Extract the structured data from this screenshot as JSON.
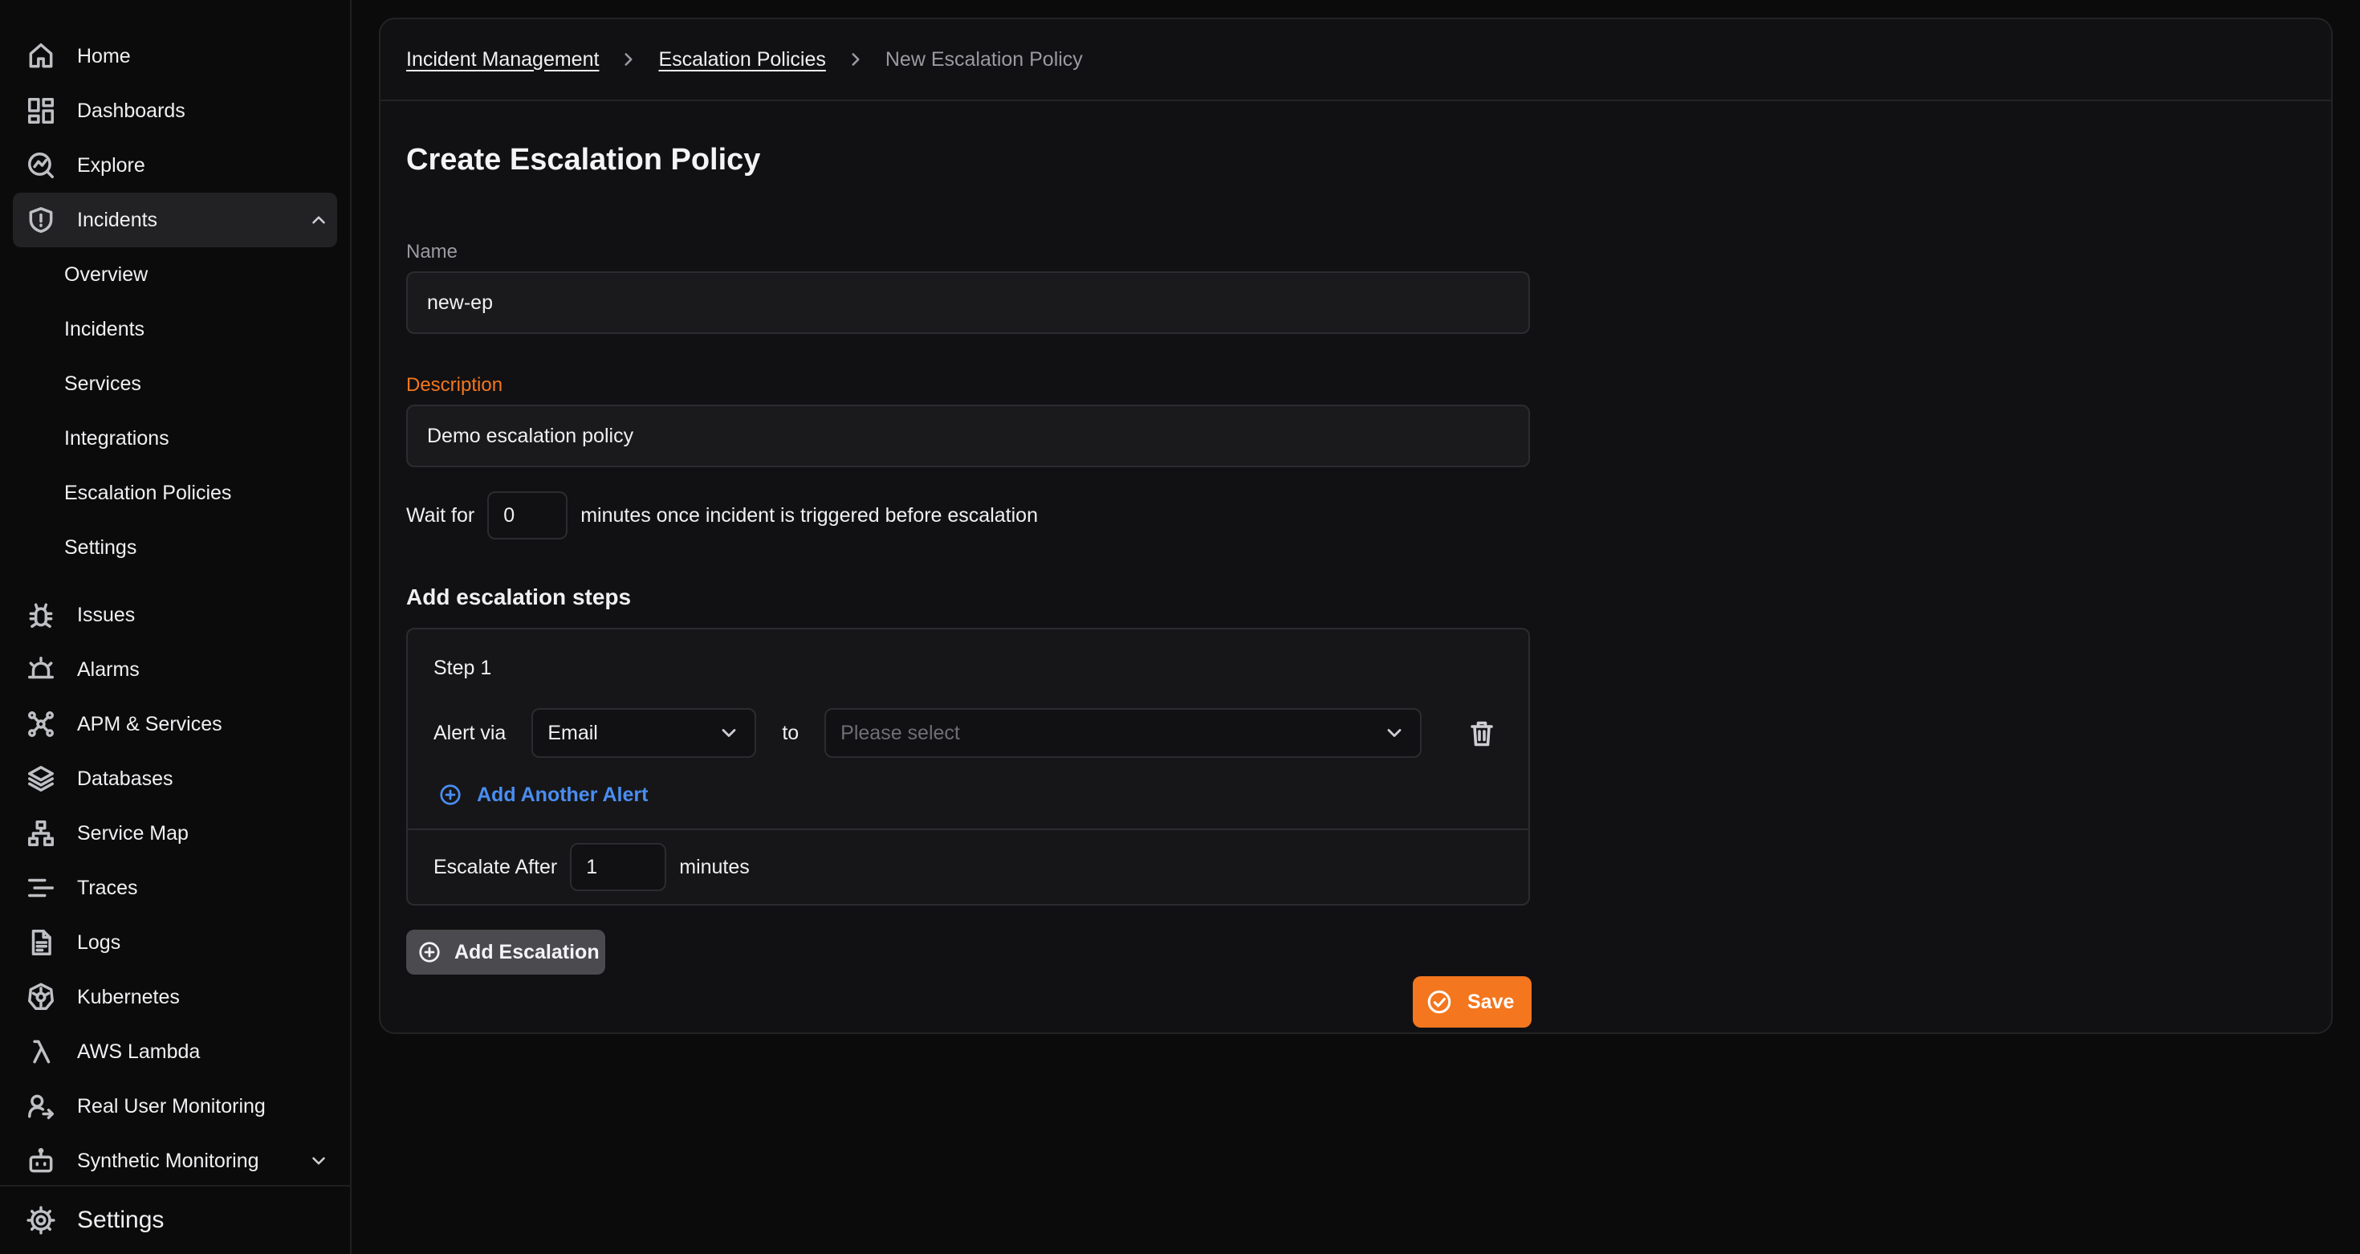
{
  "sidebar": {
    "items_top": [
      {
        "label": "Home",
        "icon": "home-icon"
      },
      {
        "label": "Dashboards",
        "icon": "dashboards-icon"
      },
      {
        "label": "Explore",
        "icon": "explore-icon"
      }
    ],
    "incidents": {
      "label": "Incidents",
      "icon": "shield-icon",
      "expanded": true
    },
    "incidents_sub": [
      "Overview",
      "Incidents",
      "Services",
      "Integrations",
      "Escalation Policies",
      "Settings"
    ],
    "items_bottom": [
      {
        "label": "Issues",
        "icon": "bug-icon"
      },
      {
        "label": "Alarms",
        "icon": "alarm-icon"
      },
      {
        "label": "APM & Services",
        "icon": "apm-icon"
      },
      {
        "label": "Databases",
        "icon": "database-icon"
      },
      {
        "label": "Service Map",
        "icon": "service-map-icon"
      },
      {
        "label": "Traces",
        "icon": "traces-icon"
      },
      {
        "label": "Logs",
        "icon": "logs-icon"
      },
      {
        "label": "Kubernetes",
        "icon": "kubernetes-icon"
      },
      {
        "label": "AWS Lambda",
        "icon": "lambda-icon"
      },
      {
        "label": "Real User Monitoring",
        "icon": "rum-icon"
      },
      {
        "label": "Synthetic Monitoring",
        "icon": "robot-icon"
      }
    ],
    "settings_label": "Settings"
  },
  "breadcrumb": {
    "items": [
      "Incident Management",
      "Escalation Policies"
    ],
    "current": "New Escalation Policy"
  },
  "form": {
    "title": "Create Escalation Policy",
    "name_label": "Name",
    "name_value": "new-ep",
    "description_label": "Description",
    "description_value": "Demo escalation policy",
    "wait_prefix": "Wait for",
    "wait_value": "0",
    "wait_suffix": "minutes once incident is triggered before escalation",
    "steps_title": "Add escalation steps",
    "step": {
      "label": "Step 1",
      "alert_via_label": "Alert via",
      "alert_via_value": "Email",
      "to_label": "to",
      "to_placeholder": "Please select",
      "add_alert_label": "Add Another Alert",
      "escalate_after_label": "Escalate After",
      "escalate_after_value": "1",
      "minutes_label": "minutes"
    },
    "add_escalation_label": "Add Escalation",
    "save_label": "Save"
  },
  "colors": {
    "accent": "#f4761e",
    "link": "#4a8df0",
    "background": "#0b0b0c",
    "card": "#111113"
  }
}
